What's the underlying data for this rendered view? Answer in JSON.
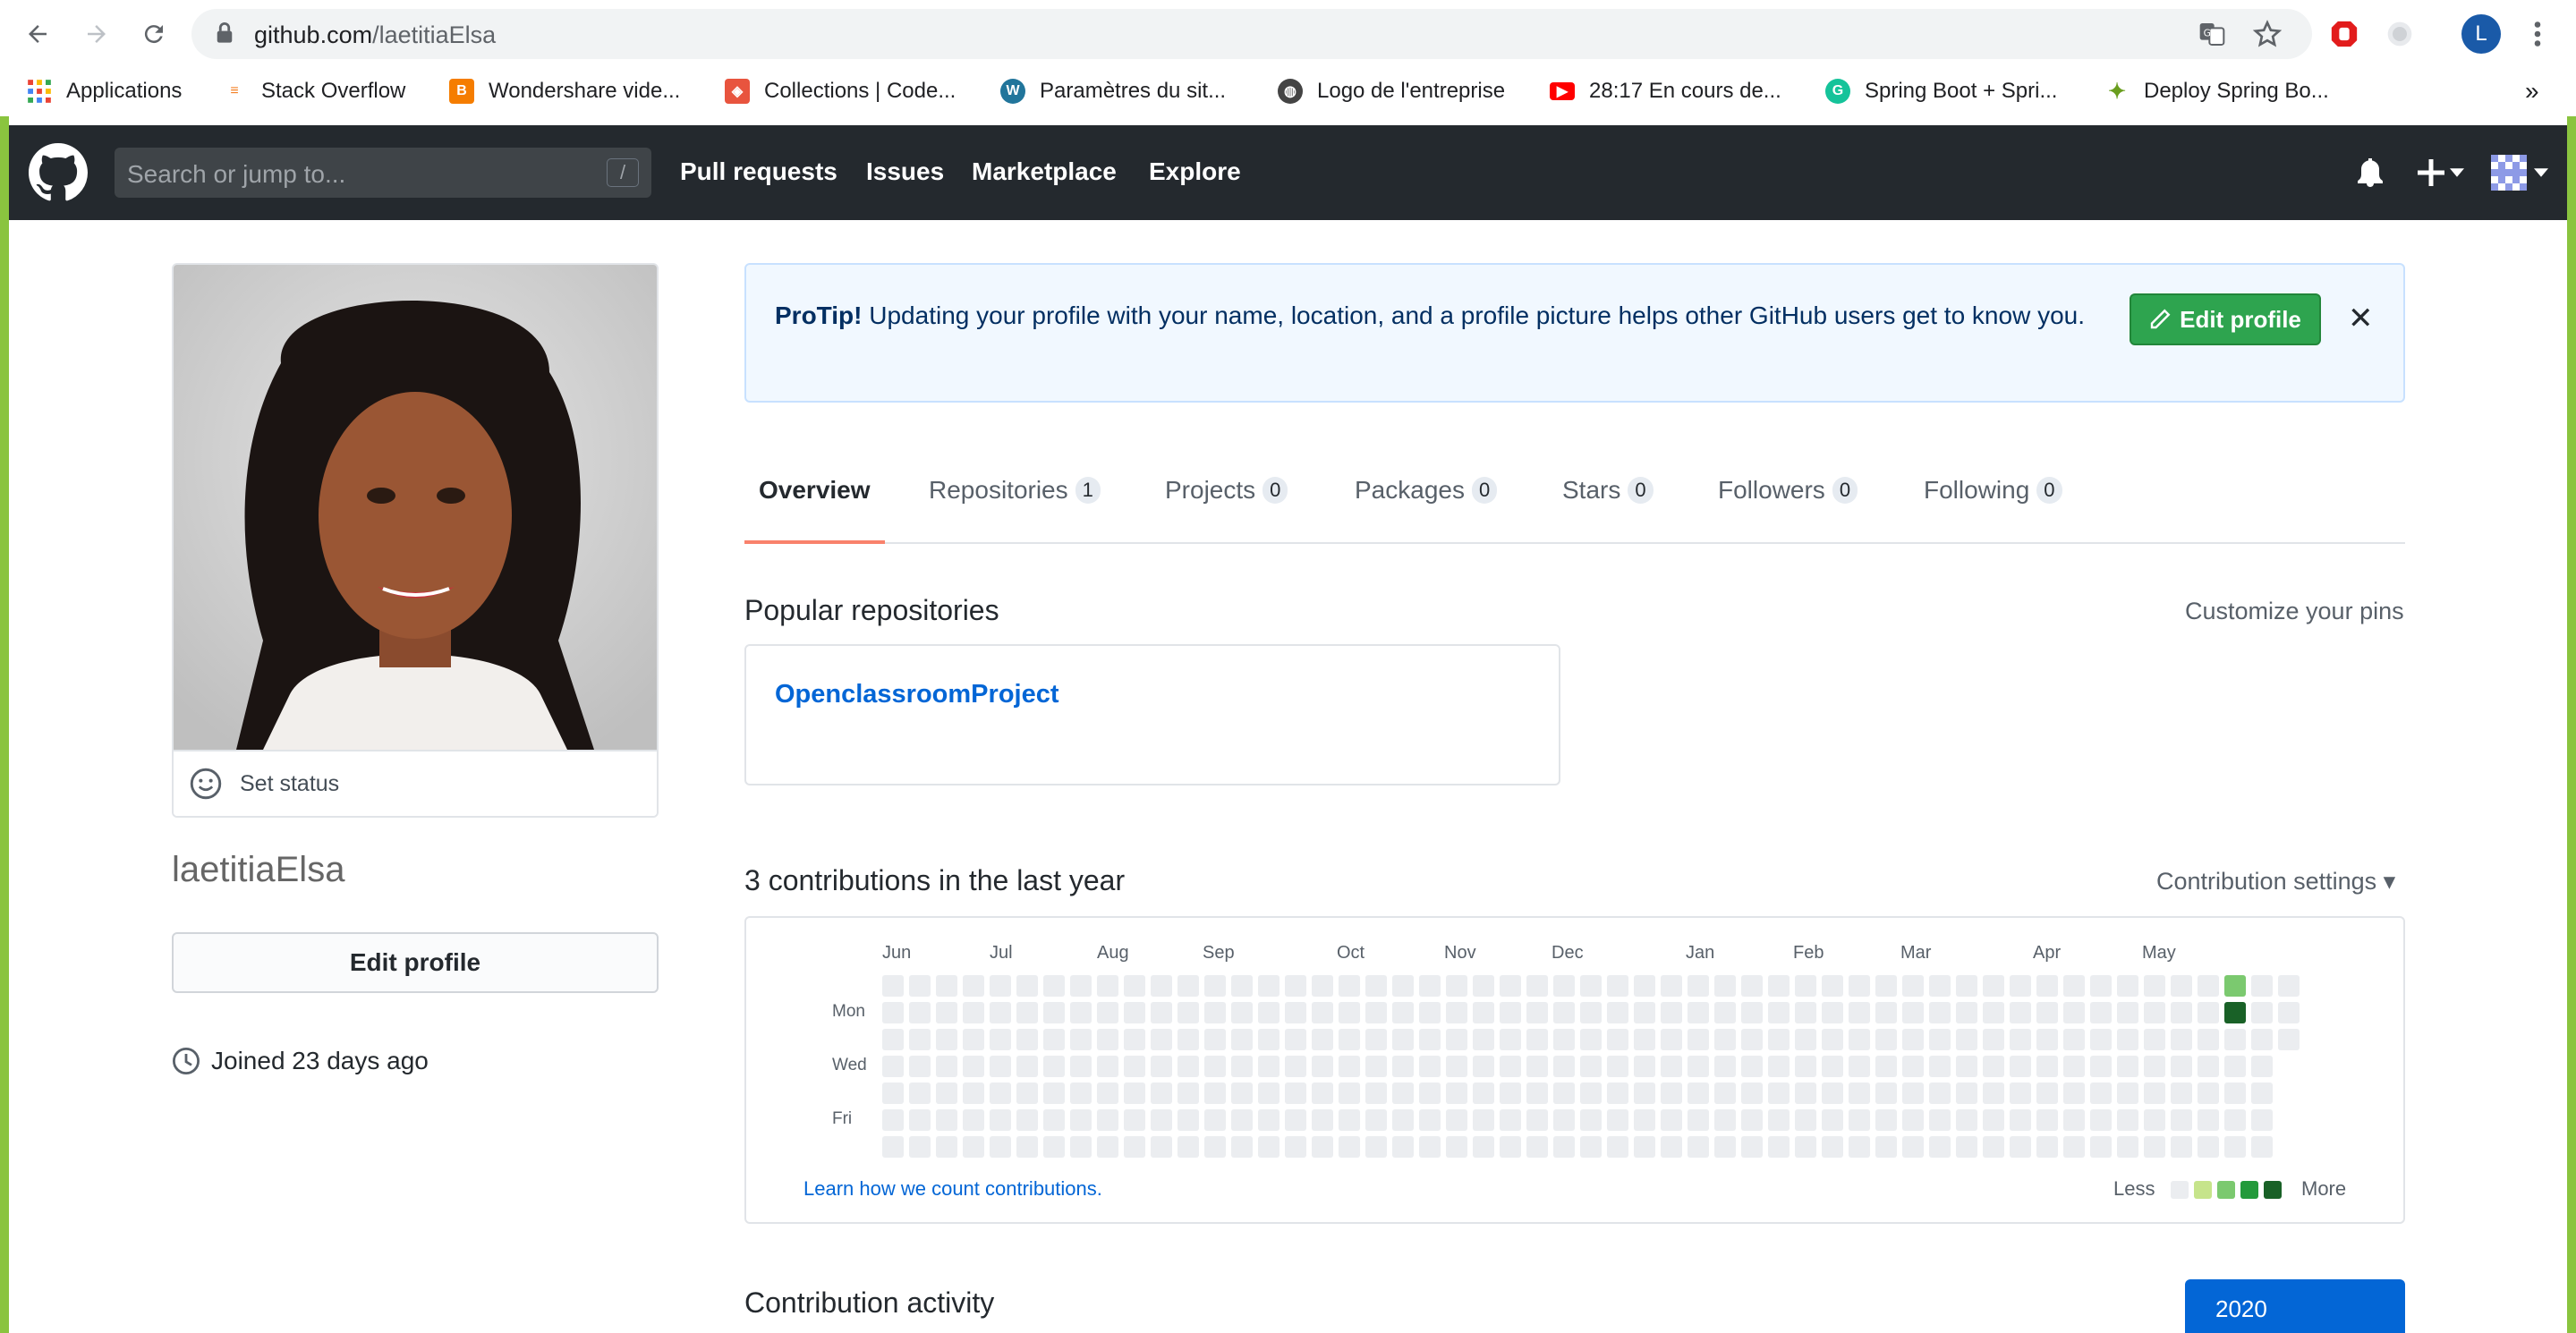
{
  "browser": {
    "url_host": "github.com",
    "url_path": "/laetitiaElsa",
    "profile_initial": "L"
  },
  "bookmarks": [
    {
      "label": "Applications",
      "icon": "apps-grid-icon",
      "color": "#ea4335"
    },
    {
      "label": "Stack Overflow",
      "icon": "stackoverflow-icon",
      "color": "#f48024"
    },
    {
      "label": "Wondershare vide...",
      "icon": "blogger-icon",
      "color": "#f57d00"
    },
    {
      "label": "Collections | Code...",
      "icon": "codepen-icon",
      "color": "#e8543e"
    },
    {
      "label": "Paramètres du sit...",
      "icon": "wordpress-icon",
      "color": "#21759b"
    },
    {
      "label": "Logo de l'entreprise",
      "icon": "globe-icon",
      "color": "#444"
    },
    {
      "label": "28:17 En cours de...",
      "icon": "youtube-icon",
      "color": "#ff0000"
    },
    {
      "label": "Spring Boot + Spri...",
      "icon": "grammarly-icon",
      "color": "#15c39a"
    },
    {
      "label": "Deploy Spring Bo...",
      "icon": "leaf-icon",
      "color": "#6a9e1f"
    }
  ],
  "gh": {
    "search_placeholder": "Search or jump to...",
    "search_key": "/",
    "nav": [
      "Pull requests",
      "Issues",
      "Marketplace",
      "Explore"
    ]
  },
  "profile": {
    "set_status": "Set status",
    "username": "laetitiaElsa",
    "edit_profile": "Edit profile",
    "joined": "Joined 23 days ago"
  },
  "protip": {
    "bold": "ProTip!",
    "text": " Updating your profile with your name, location, and a profile picture helps other GitHub users get to know you.",
    "button": "Edit profile",
    "close": "✕"
  },
  "tabs": [
    {
      "label": "Overview",
      "count": null
    },
    {
      "label": "Repositories",
      "count": "1"
    },
    {
      "label": "Projects",
      "count": "0"
    },
    {
      "label": "Packages",
      "count": "0"
    },
    {
      "label": "Stars",
      "count": "0"
    },
    {
      "label": "Followers",
      "count": "0"
    },
    {
      "label": "Following",
      "count": "0"
    }
  ],
  "popular": {
    "title": "Popular repositories",
    "customize": "Customize your pins",
    "repo": "OpenclassroomProject"
  },
  "contributions": {
    "title": "3 contributions in the last year",
    "settings": "Contribution settings ▾",
    "months": [
      "Jun",
      "Jul",
      "Aug",
      "Sep",
      "Oct",
      "Nov",
      "Dec",
      "Jan",
      "Feb",
      "Mar",
      "Apr",
      "May"
    ],
    "days": [
      "Mon",
      "Wed",
      "Fri"
    ],
    "learn": "Learn how we count contributions.",
    "less": "Less",
    "more": "More",
    "levels": [
      "#ebedf0",
      "#c6e48b",
      "#7bc96f",
      "#239a3b",
      "#196127"
    ],
    "active_cells": [
      {
        "week": 50,
        "day": 0,
        "color": "#7bc96f"
      },
      {
        "week": 50,
        "day": 1,
        "color": "#196127"
      }
    ]
  },
  "activity": {
    "title": "Contribution activity",
    "year": "2020"
  }
}
